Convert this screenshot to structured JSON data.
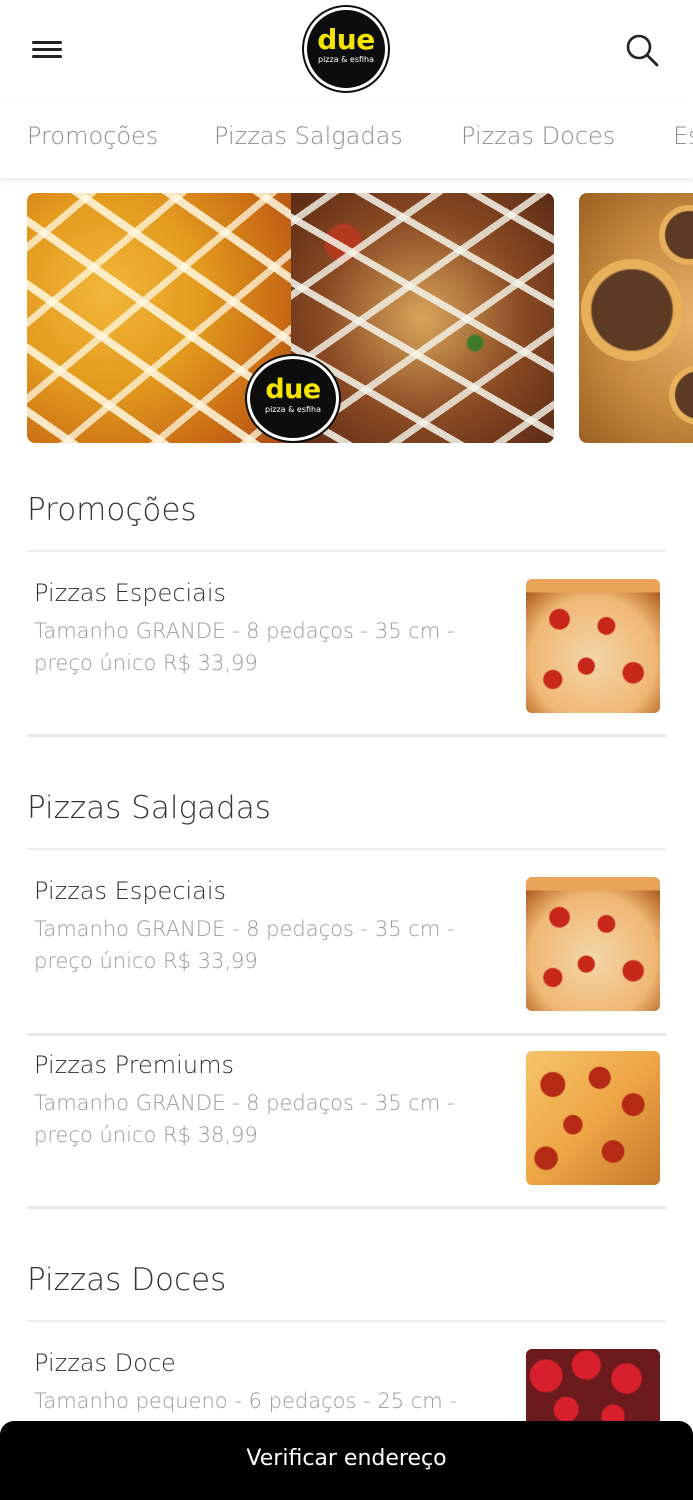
{
  "header": {
    "logo": {
      "main": "due",
      "sub": "pizza & esfiha"
    },
    "menu_icon": "hamburger-menu-icon",
    "search_icon": "search-icon"
  },
  "tabs": [
    {
      "label": "Promoções"
    },
    {
      "label": "Pizzas Salgadas"
    },
    {
      "label": "Pizzas Doces"
    },
    {
      "label": "Es"
    }
  ],
  "banners": {
    "logo": {
      "main": "due",
      "sub": "pizza & esfiha"
    }
  },
  "sections": [
    {
      "title": "Promoções",
      "items": [
        {
          "name": "Pizzas Especiais",
          "description": "Tamanho GRANDE - 8 pedaços - 35 cm - preço único R$ 33,99"
        }
      ]
    },
    {
      "title": "Pizzas Salgadas",
      "items": [
        {
          "name": "Pizzas Especiais",
          "description": "Tamanho GRANDE - 8 pedaços - 35 cm - preço único R$ 33,99"
        },
        {
          "name": "Pizzas Premiums",
          "description": "Tamanho GRANDE - 8 pedaços - 35 cm - preço único R$ 38,99"
        }
      ]
    },
    {
      "title": "Pizzas Doces",
      "items": [
        {
          "name": "Pizzas Doce",
          "description": "Tamanho pequeno - 6 pedaços - 25 cm -"
        }
      ]
    }
  ],
  "bottom_bar": {
    "label": "Verificar endereço"
  },
  "colors": {
    "logo_yellow": "#f5e400",
    "bar_black": "#000000",
    "muted_text": "#9a9a9a"
  }
}
